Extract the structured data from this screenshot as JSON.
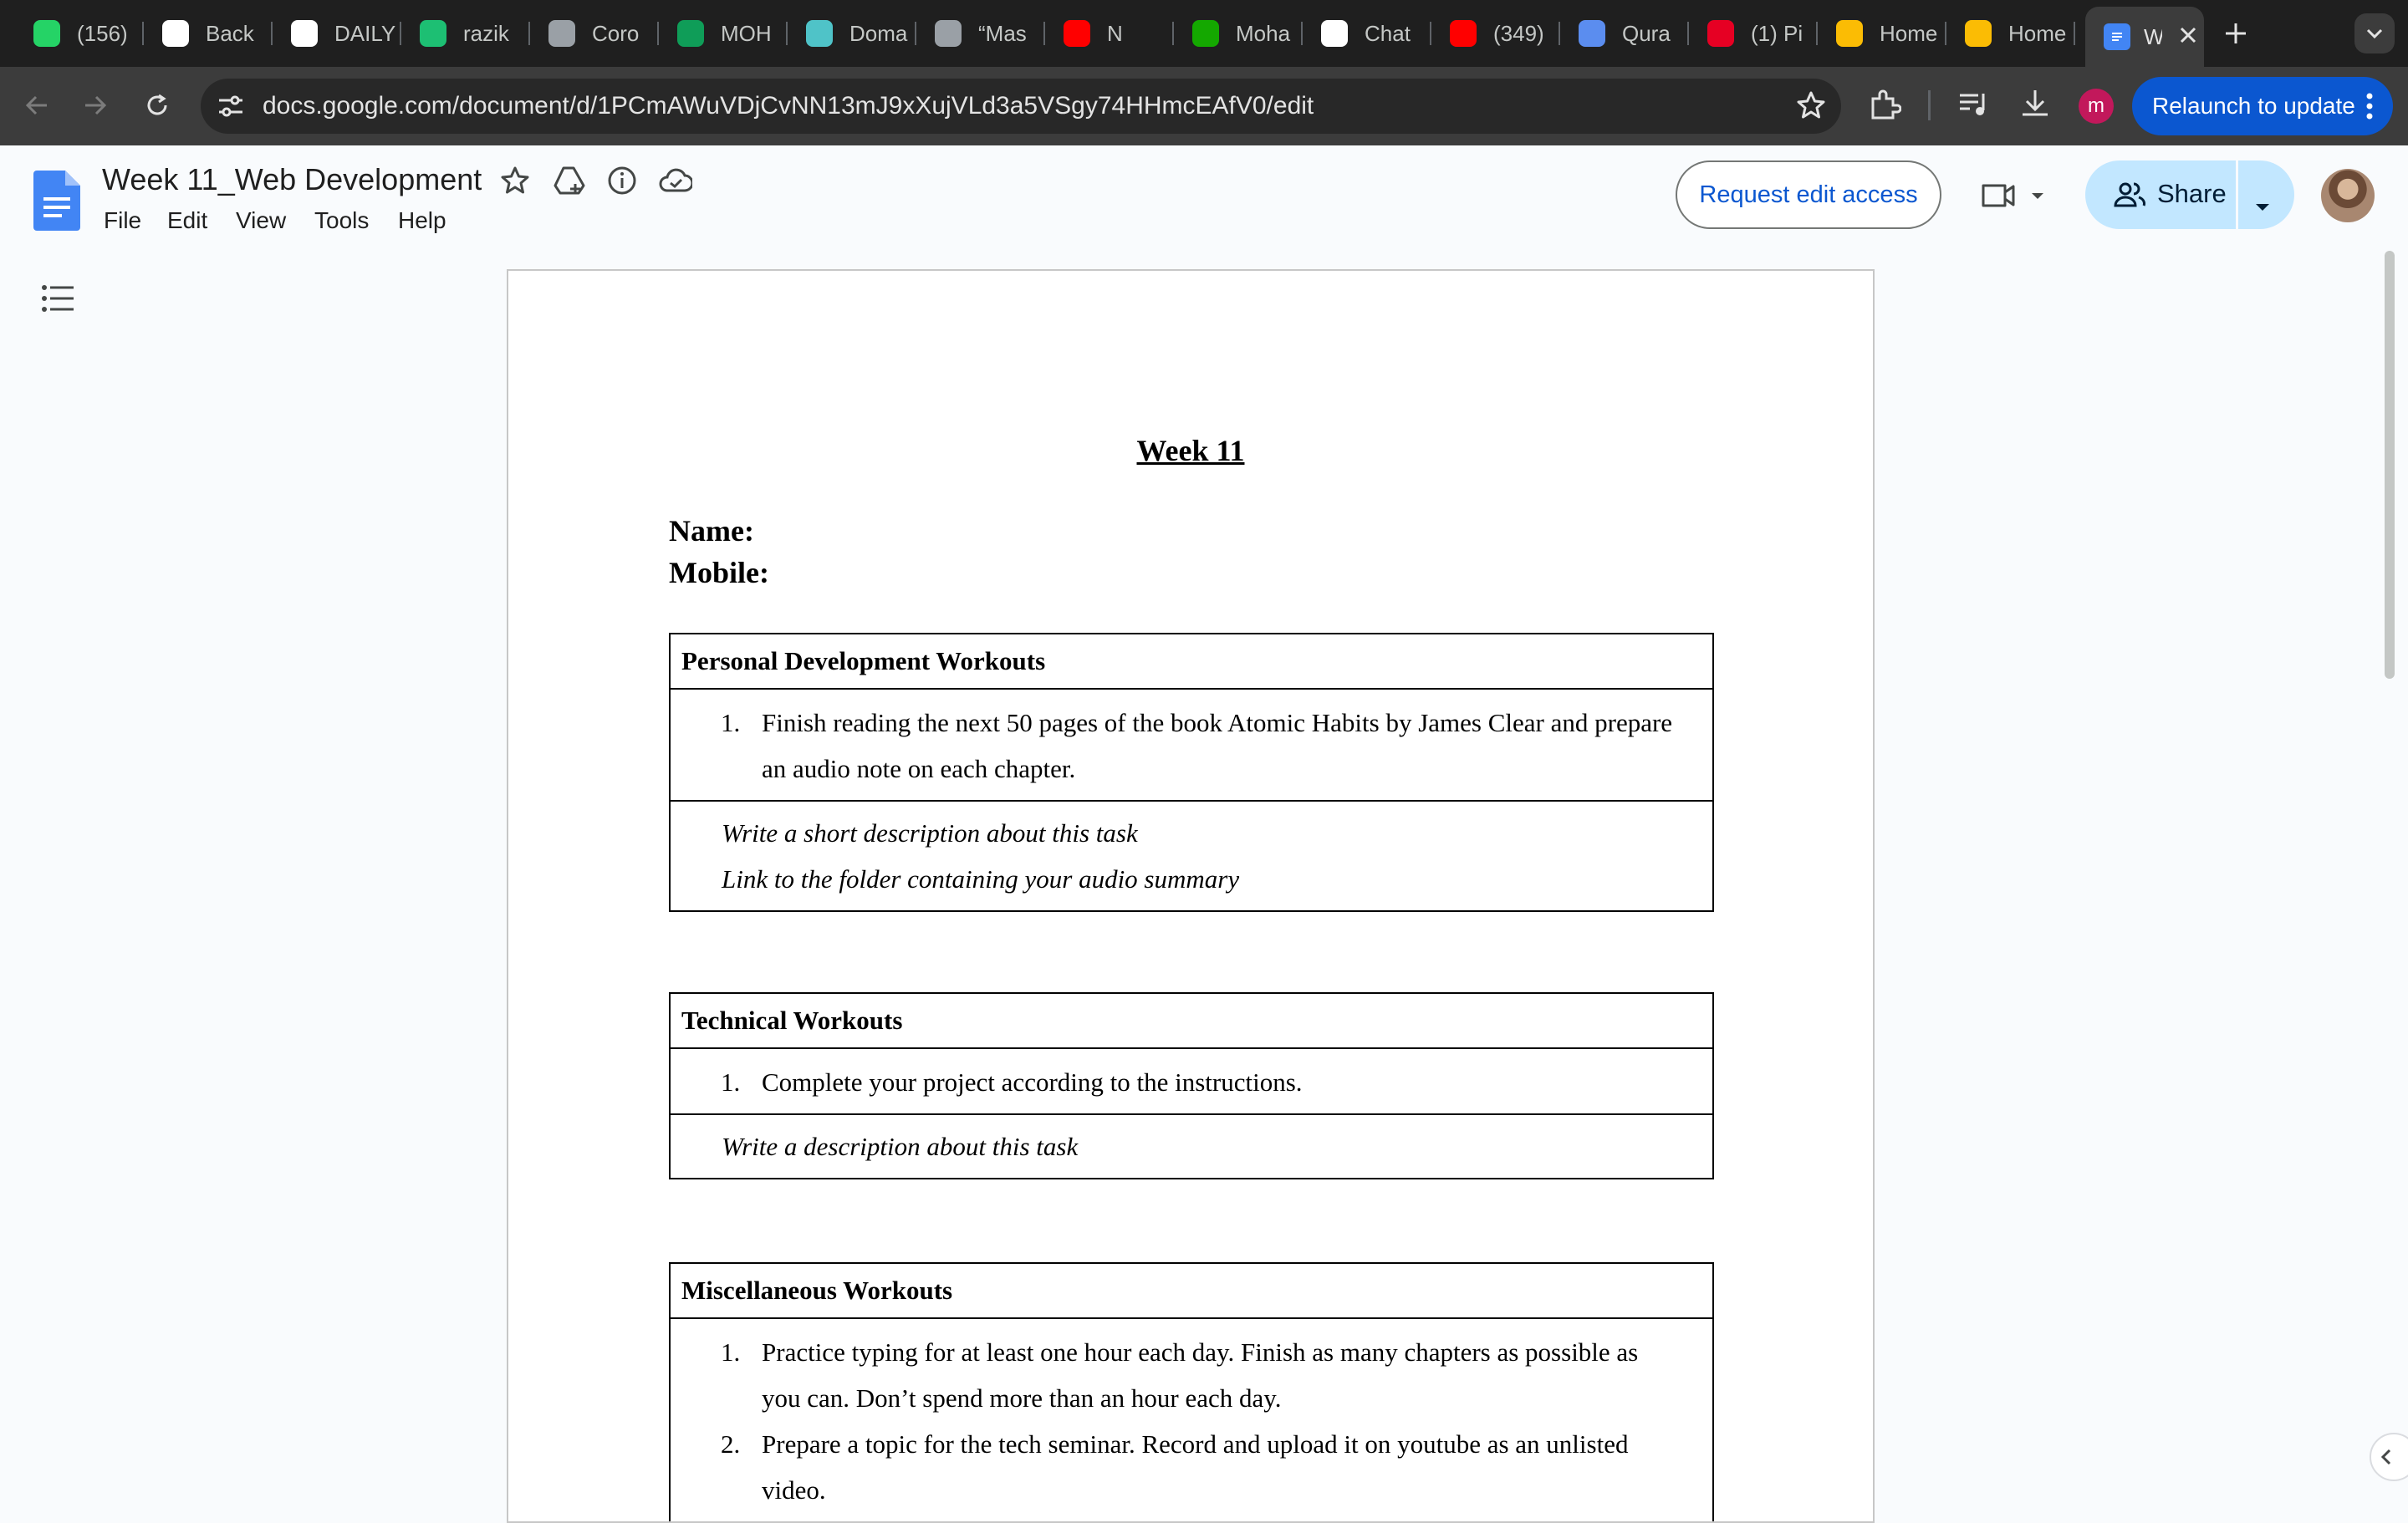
{
  "browser": {
    "tabs": [
      {
        "title": "(156)",
        "icon": "whatsapp-icon",
        "color": "#25d366"
      },
      {
        "title": "Back",
        "icon": "chatgpt-icon",
        "color": "#ffffff"
      },
      {
        "title": "DAILY",
        "icon": "notion-icon",
        "color": "#ffffff"
      },
      {
        "title": "razik",
        "icon": "fiverr-icon",
        "color": "#1dbf73"
      },
      {
        "title": "Coro",
        "icon": "layout-icon",
        "color": "#9aa0a6"
      },
      {
        "title": "MOH",
        "icon": "sheets-icon",
        "color": "#0f9d58"
      },
      {
        "title": "Doma",
        "icon": "domain-icon",
        "color": "#4fc3c8"
      },
      {
        "title": "“Mas",
        "icon": "wordpress-icon",
        "color": "#9aa0a6"
      },
      {
        "title": "N",
        "icon": "youtube-icon",
        "color": "#ff0000"
      },
      {
        "title": "Moha",
        "icon": "upwork-icon",
        "color": "#14a800"
      },
      {
        "title": "Chat",
        "icon": "chatgpt-icon",
        "color": "#ffffff"
      },
      {
        "title": "(349)",
        "icon": "youtube-icon",
        "color": "#ff0000"
      },
      {
        "title": "Qura",
        "icon": "quran-icon",
        "color": "#5b8def"
      },
      {
        "title": "(1) Pi",
        "icon": "pinterest-icon",
        "color": "#e60023"
      },
      {
        "title": "Home",
        "icon": "drive-icon",
        "color": "#fbbc04"
      },
      {
        "title": "Home",
        "icon": "drive-icon",
        "color": "#fbbc04"
      }
    ],
    "active_tab": {
      "title": "W",
      "icon": "docs-icon",
      "color": "#4285f4"
    },
    "url": "docs.google.com/document/d/1PCmAWuVDjCvNN13mJ9xXujVLd3a5VSgy74HHmcEAfV0/edit",
    "profile_initial": "m",
    "relaunch_label": "Relaunch to update"
  },
  "docs": {
    "title": "Week 11_Web Development",
    "menu": [
      "File",
      "Edit",
      "View",
      "Tools",
      "Help"
    ],
    "request_edit_label": "Request edit access",
    "share_label": "Share"
  },
  "document": {
    "heading": "Week 11",
    "name_label": "Name:",
    "mobile_label": "Mobile:",
    "tables": [
      {
        "title": "Personal Development Workouts",
        "tasks": [
          {
            "num": "1.",
            "text": "Finish reading the next 50 pages of the book Atomic Habits by James Clear and prepare an audio note on each chapter."
          }
        ],
        "notes": [
          "Write a short description about this task",
          "Link to the folder containing your audio summary"
        ]
      },
      {
        "title": "Technical Workouts",
        "tasks": [
          {
            "num": "1.",
            "text": "Complete your project according to the instructions."
          }
        ],
        "notes": [
          "Write a description about this task"
        ]
      },
      {
        "title": "Miscellaneous Workouts",
        "tasks": [
          {
            "num": "1.",
            "text": "Practice typing for at least one hour each day. Finish as many chapters as possible as you can. Don’t spend more than an hour each day."
          },
          {
            "num": "2.",
            "text": "Prepare a topic for the tech seminar. Record and upload it on youtube as an unlisted video."
          }
        ],
        "notes": []
      }
    ]
  }
}
